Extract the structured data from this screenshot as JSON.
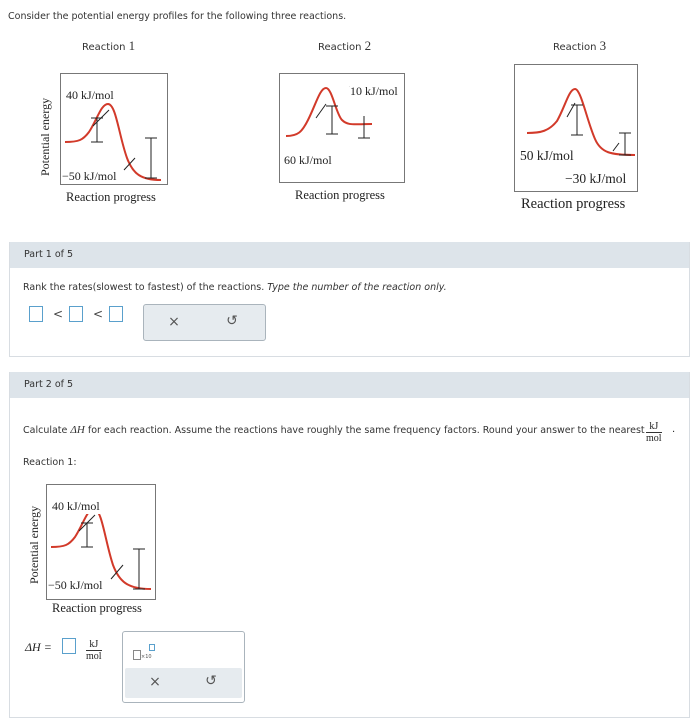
{
  "intro": "Consider the potential energy profiles for the following three reactions.",
  "reactions": [
    {
      "title": "Reaction",
      "num": "1",
      "y_label": "Potential energy",
      "top_label": "40 kJ/mol",
      "bottom_label": "−50 kJ/mol",
      "x_label": "Reaction progress"
    },
    {
      "title": "Reaction",
      "num": "2",
      "top_label": "10 kJ/mol",
      "bottom_label": "60 kJ/mol",
      "x_label": "Reaction progress"
    },
    {
      "title": "Reaction",
      "num": "3",
      "top_label": "50 kJ/mol",
      "bottom_label": "−30 kJ/mol",
      "x_label": "Reaction progress"
    }
  ],
  "part1": {
    "header": "Part 1 of 5",
    "question": "Rank the rates(slowest to fastest) of the reactions.",
    "question_italic": "Type the number of the reaction only.",
    "lt": "<",
    "clear_icon": "×",
    "undo_icon": "↺"
  },
  "part2": {
    "header": "Part 2 of 5",
    "question_prefix": "Calculate",
    "delta_h": "ΔH",
    "question_suffix": "for each reaction. Assume the reactions have roughly the same frequency factors. Round your answer to the nearest",
    "unit_num": "kJ",
    "unit_den": "mol",
    "period": ".",
    "reaction_label": "Reaction 1:",
    "plot": {
      "y_label": "Potential energy",
      "top_label": "40 kJ/mol",
      "bottom_label": "−50 kJ/mol",
      "x_label": "Reaction progress"
    },
    "answer_label": "ΔH =",
    "x10": "×10",
    "clear_icon": "×",
    "undo_icon": "↺"
  }
}
